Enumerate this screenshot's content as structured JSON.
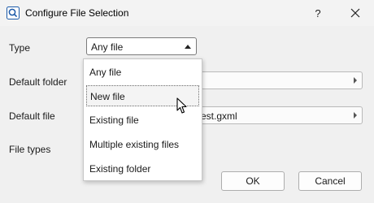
{
  "window": {
    "title": "Configure File Selection",
    "help_label": "?"
  },
  "form": {
    "type_label": "Type",
    "type_value": "Any file",
    "default_folder_label": "Default folder",
    "default_folder_value": "",
    "default_file_label": "Default file",
    "default_file_value": "est.gxml",
    "file_types_label": "File types"
  },
  "dropdown": {
    "options": [
      "Any file",
      "New file",
      "Existing file",
      "Multiple existing files",
      "Existing folder"
    ],
    "highlighted": "New file"
  },
  "buttons": {
    "ok": "OK",
    "cancel": "Cancel"
  }
}
